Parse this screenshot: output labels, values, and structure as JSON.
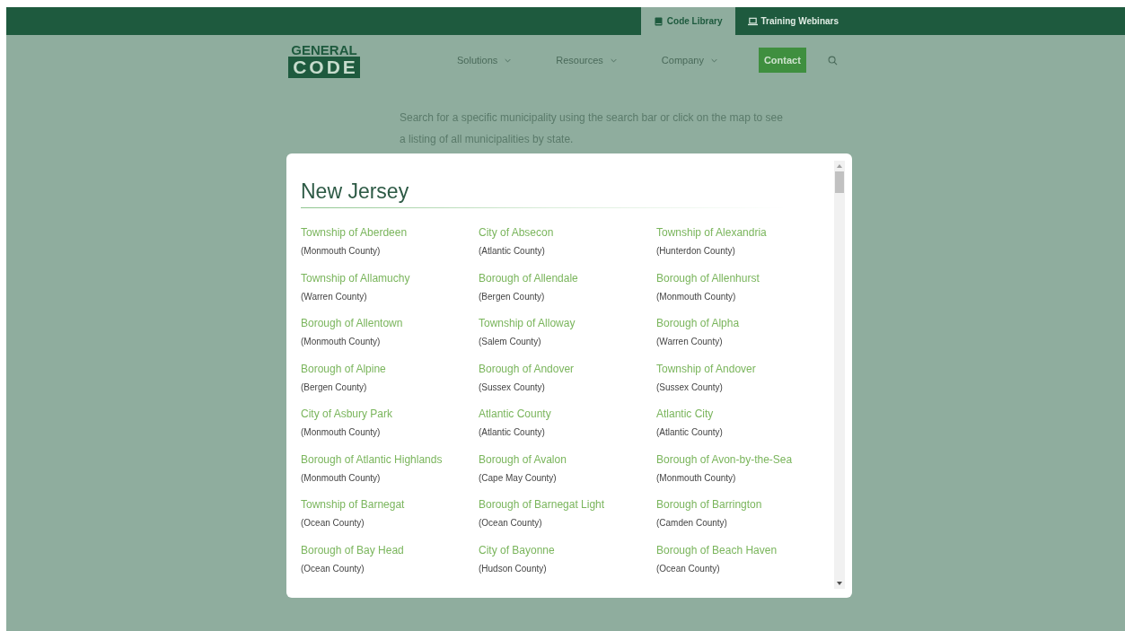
{
  "top_bar": {
    "tabs": [
      {
        "label": "Code Library",
        "selected": true,
        "kind": "book"
      },
      {
        "label": "Training Webinars",
        "selected": false,
        "kind": "laptop"
      }
    ]
  },
  "header": {
    "logo": {
      "line_1": "GENERAL",
      "line_2": "CODE"
    },
    "nav": [
      {
        "label": "Solutions"
      },
      {
        "label": "Resources"
      },
      {
        "label": "Company"
      }
    ],
    "contact_button": "Contact"
  },
  "intro": "Search for a specific municipality using the search bar or click on the map to see a listing of all municipalities by state.",
  "modal": {
    "title": "New Jersey",
    "municipalities": [
      {
        "name": "Township of Aberdeen",
        "county": "(Monmouth County)"
      },
      {
        "name": "City of Absecon",
        "county": "(Atlantic County)"
      },
      {
        "name": "Township of Alexandria",
        "county": "(Hunterdon County)"
      },
      {
        "name": "Township of Allamuchy",
        "county": "(Warren County)"
      },
      {
        "name": "Borough of Allendale",
        "county": "(Bergen County)"
      },
      {
        "name": "Borough of Allenhurst",
        "county": "(Monmouth County)"
      },
      {
        "name": "Borough of Allentown",
        "county": "(Monmouth County)"
      },
      {
        "name": "Township of Alloway",
        "county": "(Salem County)"
      },
      {
        "name": "Borough of Alpha",
        "county": "(Warren County)"
      },
      {
        "name": "Borough of Alpine",
        "county": "(Bergen County)"
      },
      {
        "name": "Borough of Andover",
        "county": "(Sussex County)"
      },
      {
        "name": "Township of Andover",
        "county": "(Sussex County)"
      },
      {
        "name": "City of Asbury Park",
        "county": "(Monmouth County)"
      },
      {
        "name": "Atlantic County",
        "county": "(Atlantic County)"
      },
      {
        "name": "Atlantic City",
        "county": "(Atlantic County)"
      },
      {
        "name": "Borough of Atlantic Highlands",
        "county": "(Monmouth County)"
      },
      {
        "name": "Borough of Avalon",
        "county": "(Cape May County)"
      },
      {
        "name": "Borough of Avon-by-the-Sea",
        "county": "(Monmouth County)"
      },
      {
        "name": "Township of Barnegat",
        "county": "(Ocean County)"
      },
      {
        "name": "Borough of Barnegat Light",
        "county": "(Ocean County)"
      },
      {
        "name": "Borough of Barrington",
        "county": "(Camden County)"
      },
      {
        "name": "Borough of Bay Head",
        "county": "(Ocean County)"
      },
      {
        "name": "City of Bayonne",
        "county": "(Hudson County)"
      },
      {
        "name": "Borough of Beach Haven",
        "county": "(Ocean County)"
      }
    ]
  }
}
